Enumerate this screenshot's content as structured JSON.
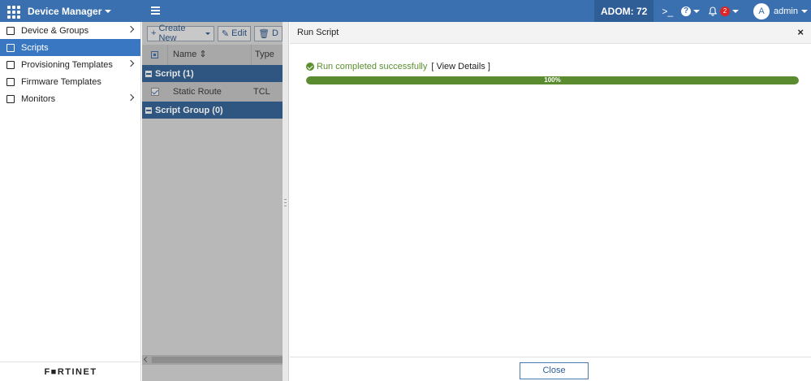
{
  "topbar": {
    "app_title": "Device Manager",
    "adom_label": "ADOM: 72",
    "notification_count": "2",
    "avatar_initial": "A",
    "username": "admin"
  },
  "sidebar": {
    "items": [
      {
        "label": "Device & Groups",
        "icon": "devices-icon",
        "has_submenu": true,
        "active": false
      },
      {
        "label": "Scripts",
        "icon": "scripts-icon",
        "has_submenu": false,
        "active": true
      },
      {
        "label": "Provisioning Templates",
        "icon": "template-icon",
        "has_submenu": true,
        "active": false
      },
      {
        "label": "Firmware Templates",
        "icon": "chip-icon",
        "has_submenu": false,
        "active": false
      },
      {
        "label": "Monitors",
        "icon": "monitor-icon",
        "has_submenu": true,
        "active": false
      }
    ],
    "brand": "F■RTINET"
  },
  "scripts_panel": {
    "toolbar": {
      "create_new": "Create New",
      "edit": "Edit",
      "delete": "D"
    },
    "columns": {
      "name": "Name",
      "type": "Type"
    },
    "groups": [
      {
        "label": "Script (1)"
      },
      {
        "label": "Script Group (0)"
      }
    ],
    "rows": [
      {
        "name": "Static Route",
        "type": "TCL",
        "checked": true
      }
    ]
  },
  "dialog": {
    "title": "Run Script",
    "status_text": "Run completed successfully",
    "details_link": "[ View Details ]",
    "progress_value": 100,
    "progress_text": "100%",
    "close_button": "Close"
  },
  "colors": {
    "topbar": "#3a6fb0",
    "sidebar_active": "#3a77c2",
    "success_green": "#5a8f2e",
    "group_row": "#2f5680"
  }
}
